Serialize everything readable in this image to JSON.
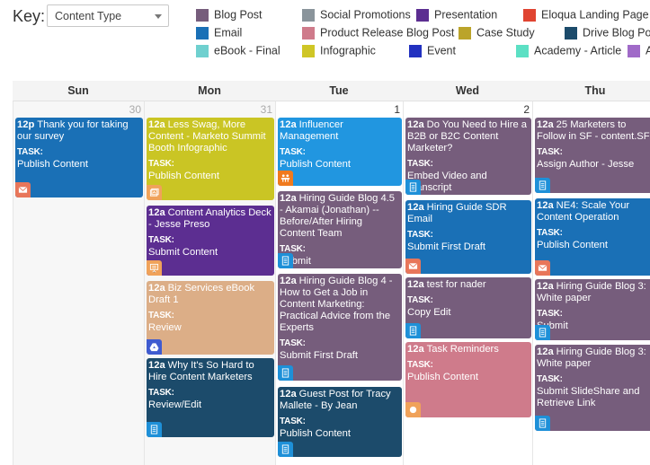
{
  "key": {
    "label": "Key:",
    "select_value": "Content Type"
  },
  "legend": [
    {
      "label": "Blog Post",
      "color": "#765d7c"
    },
    {
      "label": "Email",
      "color": "#1a70b6"
    },
    {
      "label": "eBook - Final",
      "color": "#6fd0cf"
    },
    {
      "label": "Social Promotions",
      "color": "#8a949b"
    },
    {
      "label": "Product Release Blog Post",
      "color": "#cf7b8b"
    },
    {
      "label": "Infographic",
      "color": "#cfc626"
    },
    {
      "label": "Presentation",
      "color": "#5c2e91"
    },
    {
      "label": "Case Study",
      "color": "#bba42a"
    },
    {
      "label": "Event",
      "color": "#2231c0"
    },
    {
      "label": "Eloqua Landing Page",
      "color": "#e04431"
    },
    {
      "label": "Drive Blog Post",
      "color": "#1c4b6b"
    },
    {
      "label": "Academy - Article",
      "color": "#5ce0c4"
    },
    {
      "label": "Academy",
      "color": "#a06ac8"
    }
  ],
  "calendar": {
    "task_label": "TASK:",
    "days": [
      {
        "name": "Sun",
        "num": "30",
        "other_month": true,
        "events": [
          {
            "time": "12p",
            "title": "Thank you for taking our survey",
            "task": "Publish Content",
            "color": "#1a70b6",
            "icon": "email-icon",
            "icon_color": "#e8765a"
          }
        ]
      },
      {
        "name": "Mon",
        "num": "31",
        "other_month": true,
        "events": [
          {
            "time": "12a",
            "title": "Less Swag, More Content - Marketo Summit Booth Infographic",
            "task": "Publish Content",
            "color": "#cac524",
            "icon": "image-icon",
            "icon_color": "#f0a25a"
          },
          {
            "time": "12a",
            "title": "Content Analytics Deck - Jesse Preso",
            "task": "Submit Content",
            "color": "#5c2e91",
            "icon": "presentation-icon",
            "icon_color": "#f0a25a"
          },
          {
            "time": "12a",
            "title": "Biz Services eBook Draft 1",
            "task": "Review",
            "color": "#dcae87",
            "icon": "drive-icon",
            "icon_color": "#3f5bd0"
          },
          {
            "time": "12a",
            "title": "Why It's So Hard to Hire Content Marketers",
            "task": "Review/Edit",
            "color": "#1c4b6b",
            "icon": "document-icon",
            "icon_color": "#1e90d8"
          }
        ]
      },
      {
        "name": "Tue",
        "num": "1",
        "other_month": false,
        "events": [
          {
            "time": "12a",
            "title": "Influencer Management",
            "task": "Publish Content",
            "color": "#2196e0",
            "icon": "group-icon",
            "icon_color": "#f07a1e"
          },
          {
            "time": "12a",
            "title": "Hiring Guide Blog 4.5 - Akamai (Jonathan) -- Before/After Hiring Content Team",
            "task": "Submit",
            "color": "#765d7c",
            "icon": "document-icon",
            "icon_color": "#1e90d8"
          },
          {
            "time": "12a",
            "title": "Hiring Guide Blog 4 - How to Get a Job in Content Marketing: Practical Advice from the Experts",
            "task": "Submit First Draft",
            "color": "#765d7c",
            "icon": "document-icon",
            "icon_color": "#1e90d8"
          },
          {
            "time": "12a",
            "title": "Guest Post for Tracy Mallete - By Jean",
            "task": "Publish Content",
            "color": "#1c4b6b",
            "icon": "document-icon",
            "icon_color": "#1e90d8"
          }
        ]
      },
      {
        "name": "Wed",
        "num": "2",
        "other_month": false,
        "events": [
          {
            "time": "12a",
            "title": "Do You Need to Hire a B2B or B2C Content Marketer?",
            "task": "Embed Video and Transcript",
            "color": "#765d7c",
            "icon": "document-icon",
            "icon_color": "#1e90d8"
          },
          {
            "time": "12a",
            "title": "Hiring Guide SDR Email",
            "task": "Submit First Draft",
            "color": "#1a70b6",
            "icon": "email-icon",
            "icon_color": "#e8765a"
          },
          {
            "time": "12a",
            "title": "test for nader",
            "task": "Copy Edit",
            "color": "#765d7c",
            "icon": "document-icon",
            "icon_color": "#1e90d8"
          },
          {
            "time": "12a",
            "title": "Task Reminders",
            "task": "Publish Content",
            "color": "#cf7b8b",
            "icon": "circle-icon",
            "icon_color": "#f0a25a"
          }
        ]
      },
      {
        "name": "Thu",
        "num": "",
        "other_month": false,
        "events": [
          {
            "time": "12a",
            "title": "25 Marketers to Follow in SF - content.SF",
            "task": "Assign Author - Jesse",
            "color": "#765d7c",
            "icon": "document-icon",
            "icon_color": "#1e90d8"
          },
          {
            "time": "12a",
            "title": "NE4: Scale Your Content Operation",
            "task": "Publish Content",
            "color": "#1a70b6",
            "icon": "email-icon",
            "icon_color": "#e8765a"
          },
          {
            "time": "12a",
            "title": "Hiring Guide Blog 3: White paper",
            "task": "Submit",
            "color": "#765d7c",
            "icon": "document-icon",
            "icon_color": "#1e90d8"
          },
          {
            "time": "12a",
            "title": "Hiring Guide Blog 3: White paper",
            "task": "Submit SlideShare and Retrieve Link",
            "color": "#765d7c",
            "icon": "document-icon",
            "icon_color": "#1e90d8"
          }
        ]
      }
    ]
  }
}
